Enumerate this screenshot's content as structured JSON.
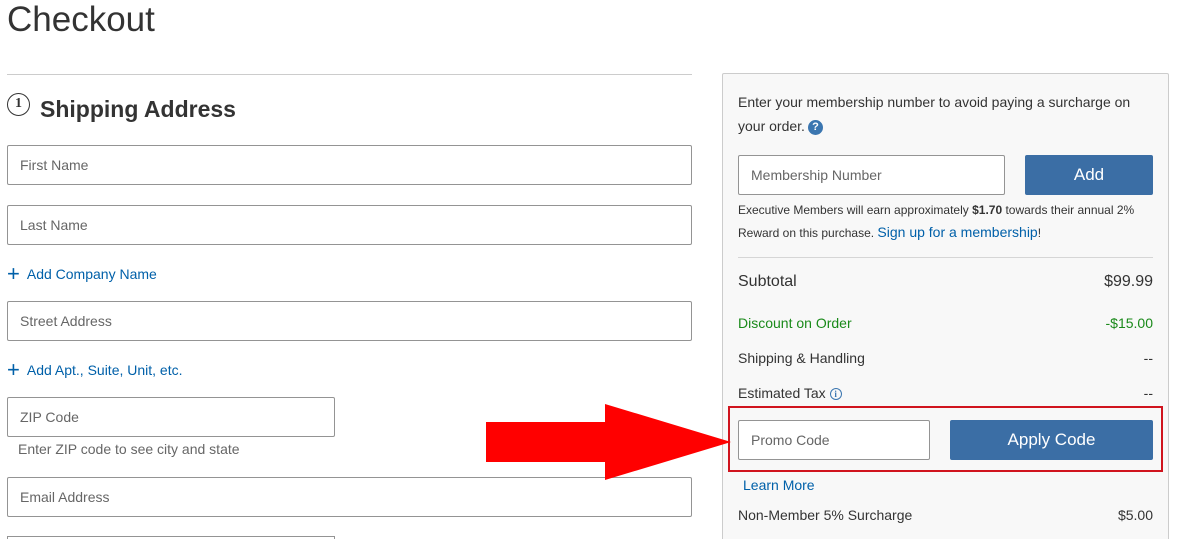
{
  "page": {
    "title": "Checkout"
  },
  "shipping": {
    "step": "1",
    "title": "Shipping Address",
    "first_name_placeholder": "First Name",
    "last_name_placeholder": "Last Name",
    "add_company": "Add Company Name",
    "street_placeholder": "Street Address",
    "add_apt": "Add Apt., Suite, Unit, etc.",
    "zip_placeholder": "ZIP Code",
    "zip_hint": "Enter ZIP code to see city and state",
    "email_placeholder": "Email Address"
  },
  "membership": {
    "intro": "Enter your membership number to avoid paying a surcharge on your order.",
    "help_icon": "?",
    "input_placeholder": "Membership Number",
    "add_label": "Add",
    "exec_prefix": "Executive Members will earn approximately ",
    "exec_amount": "$1.70",
    "exec_suffix": " towards their annual 2% Reward on this purchase. ",
    "signup_label": "Sign up for a membership",
    "signup_end": "!"
  },
  "summary": {
    "subtotal_label": "Subtotal",
    "subtotal_value": "$99.99",
    "discount_label": "Discount on Order",
    "discount_value": "-$15.00",
    "shipping_label": "Shipping & Handling",
    "shipping_value": "--",
    "tax_label": "Estimated Tax",
    "tax_value": "--",
    "surcharge_label": "Non-Member 5% Surcharge",
    "surcharge_value": "$5.00"
  },
  "promo": {
    "placeholder": "Promo Code",
    "apply_label": "Apply Code",
    "learn_more": "Learn More"
  },
  "colors": {
    "accent_button": "#3b6ea5",
    "link": "#0060a9",
    "discount": "#1a8a1a",
    "highlight_border": "#d0141e",
    "arrow": "#ff0000"
  }
}
